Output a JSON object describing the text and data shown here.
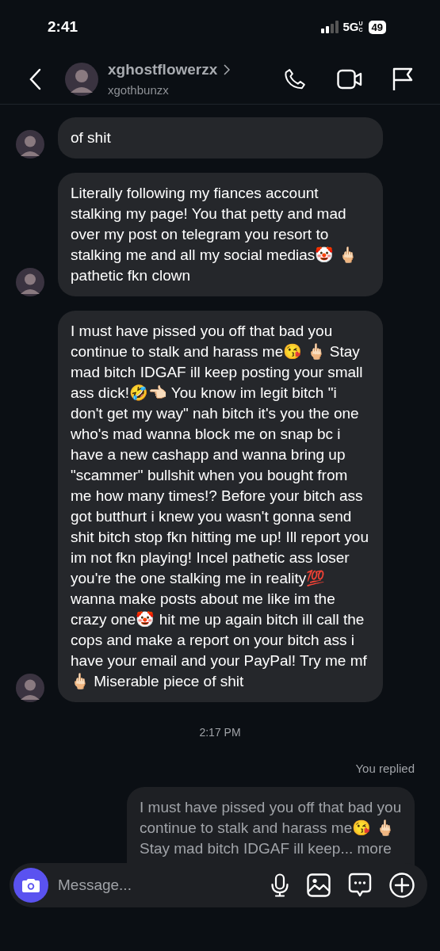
{
  "status_bar": {
    "time": "2:41",
    "network": "5G",
    "network_suffix": "UC",
    "battery": "49"
  },
  "header": {
    "name": "xghostflowerzx",
    "username": "xgothbunzx"
  },
  "thread": [
    {
      "kind": "received",
      "text": "of shit"
    },
    {
      "kind": "received",
      "text": "Literally following my fiances account stalking my page! You that petty and mad over my post on telegram you resort to stalking me and all my social medias🤡 🖕🏻 pathetic fkn clown"
    },
    {
      "kind": "received",
      "text": "I must have pissed you off that bad you continue to stalk and harass me😘 🖕🏻 Stay mad bitch IDGAF ill keep posting your small ass dick!🤣👈🏻 You know im legit bitch \"i don't get my way\" nah bitch it's you the one who's mad wanna block me on snap bc i have a new cashapp and wanna bring up \"scammer\" bullshit when you bought from me how many times!? Before your bitch ass got butthurt i knew you wasn't gonna send shit bitch stop fkn hitting me up! Ill report you im not fkn playing! Incel pathetic ass loser you're the one stalking me in reality💯 wanna make posts about me like im the crazy one🤡 hit me up again bitch ill call the cops and make a report on your bitch ass i have your email and your PayPal! Try me mf 🖕🏻 Miserable piece of shit"
    },
    {
      "kind": "timestamp",
      "text": "2:17 PM"
    },
    {
      "kind": "label",
      "text": "You replied"
    },
    {
      "kind": "sent",
      "text": "I must have pissed you off that bad you continue to stalk and harass me😘 🖕🏻 Stay mad bitch IDGAF ill keep...",
      "more": "more"
    }
  ],
  "composer": {
    "placeholder": "Message..."
  }
}
